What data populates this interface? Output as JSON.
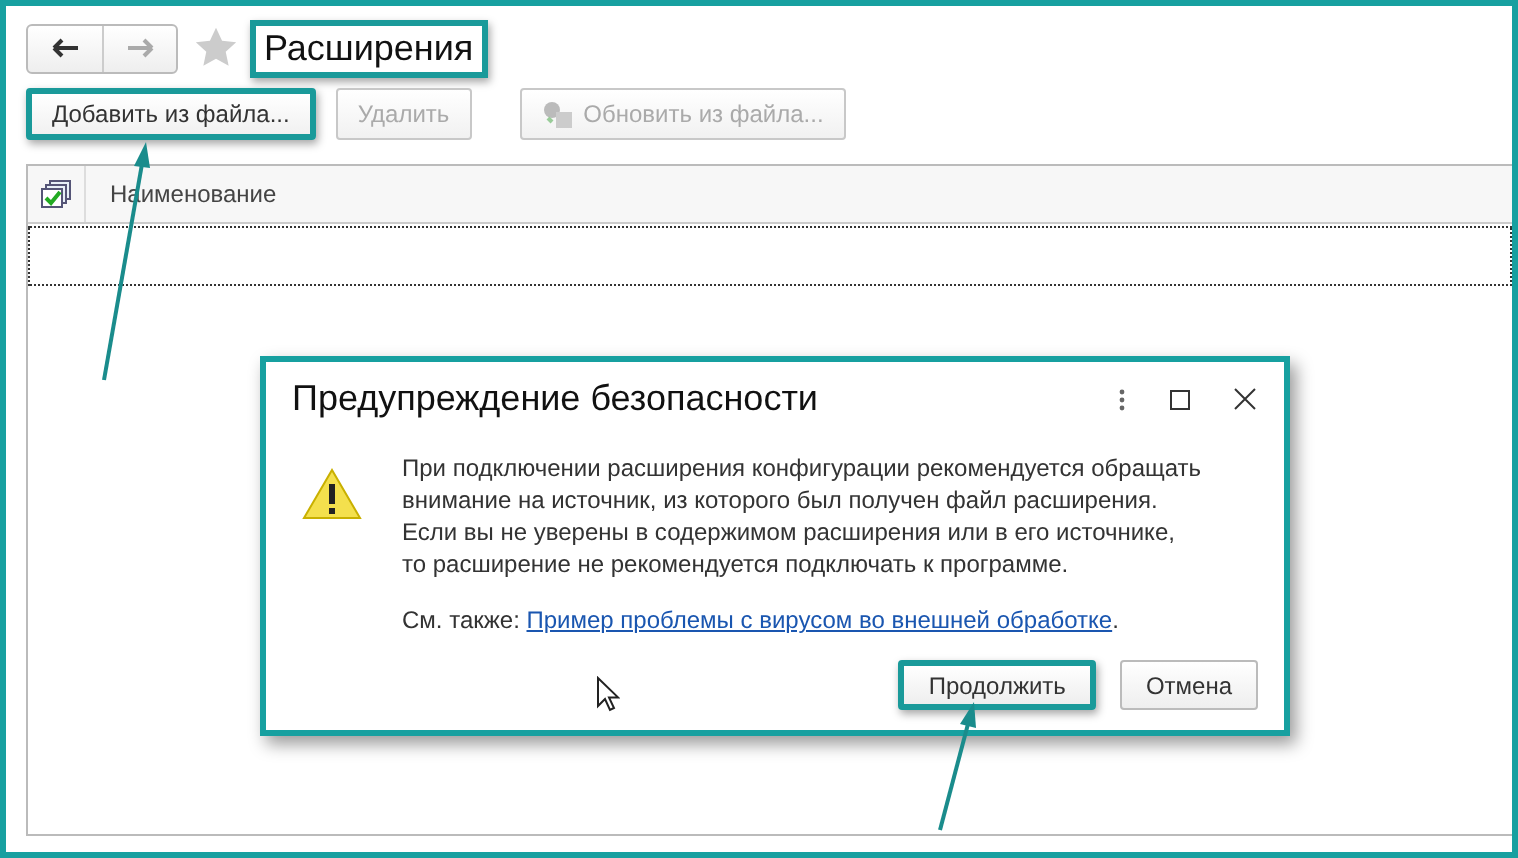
{
  "window": {
    "title": "Расширения",
    "title_highlighted": true,
    "favorite": false
  },
  "toolbar": [
    {
      "label": "Добавить из файла...",
      "disabled": false,
      "highlighted": true,
      "kind": "plain"
    },
    {
      "label": "Удалить",
      "disabled": true,
      "highlighted": false,
      "kind": "plain"
    },
    {
      "label": "Обновить из файла...",
      "disabled": true,
      "highlighted": false,
      "kind": "icon"
    }
  ],
  "table": {
    "columns": [
      "Наименование"
    ]
  },
  "dialog": {
    "title": "Предупреждение безопасности",
    "message": [
      "При подключении расширения конфигурации рекомендуется обращать",
      "внимание на источник, из которого был получен файл расширения.",
      "Если вы не уверены в содержимом расширения или в его источнике,",
      "то расширение не рекомендуется подключать к программе."
    ],
    "see_also_label": "См. также:",
    "see_also_link": "Пример проблемы с вирусом во внешней обработке",
    "see_also_end": ".",
    "buttons": [
      {
        "label": "Продолжить",
        "default": true,
        "highlighted": true
      },
      {
        "label": "Отмена",
        "default": false,
        "highlighted": false
      }
    ]
  }
}
